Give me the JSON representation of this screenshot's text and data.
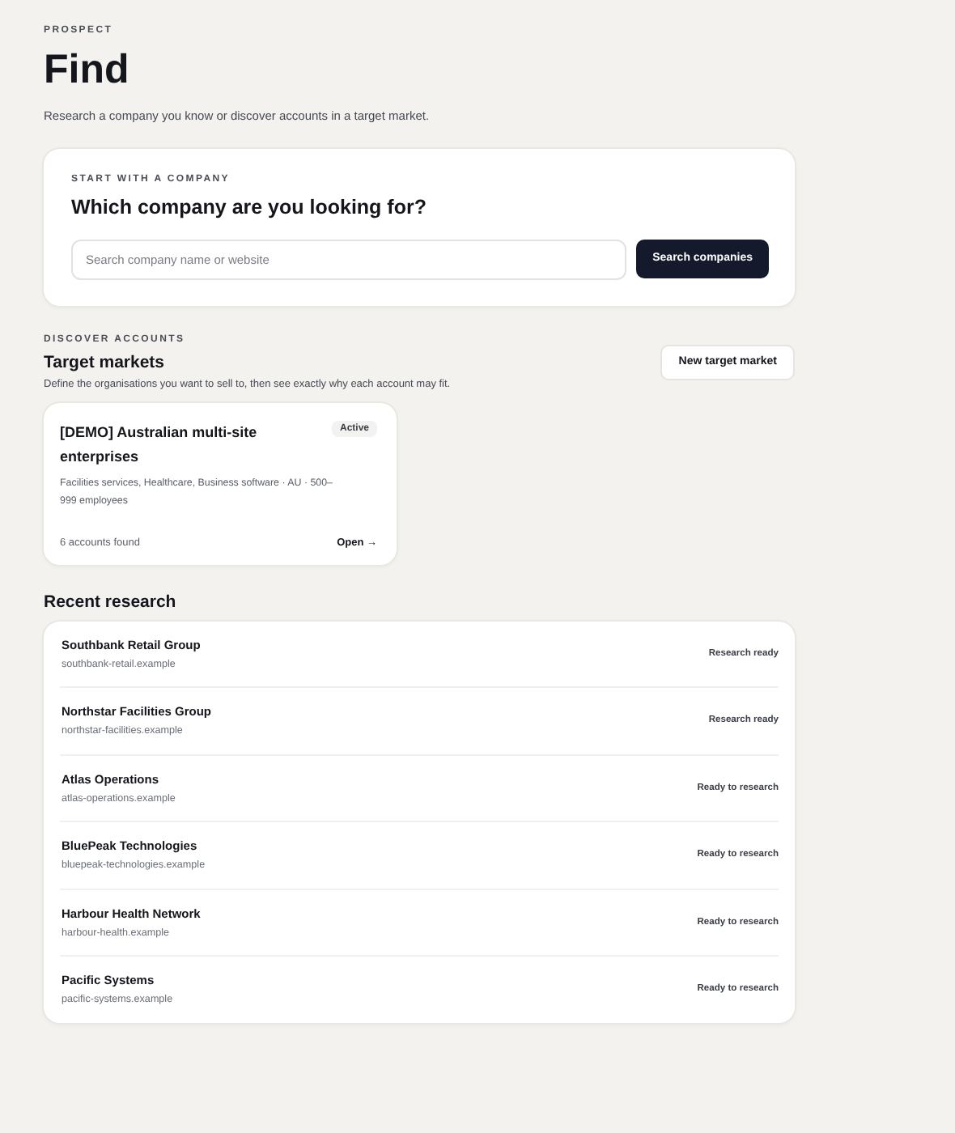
{
  "header": {
    "eyebrow": "PROSPECT",
    "title": "Find",
    "subtitle": "Research a company you know or discover accounts in a target market."
  },
  "company_search": {
    "eyebrow": "START WITH A COMPANY",
    "title": "Which company are you looking for?",
    "placeholder": "Search company name or website",
    "button": "Search companies"
  },
  "discover": {
    "eyebrow": "DISCOVER ACCOUNTS",
    "title": "Target markets",
    "description": "Define the organisations you want to sell to, then see exactly why each account may fit.",
    "button": "New target market",
    "markets": [
      {
        "name": "[DEMO] Australian multi-site enterprises",
        "badge": "Active",
        "details": "Facilities services, Healthcare, Business software · AU · 500–999 employees",
        "count": "6 accounts found",
        "link": "Open →"
      }
    ]
  },
  "recent_research": {
    "title": "Recent research",
    "items": [
      {
        "name": "Southbank Retail Group",
        "domain": "southbank-retail.example",
        "status": "Research ready"
      },
      {
        "name": "Northstar Facilities Group",
        "domain": "northstar-facilities.example",
        "status": "Research ready"
      },
      {
        "name": "Atlas Operations",
        "domain": "atlas-operations.example",
        "status": "Ready to research"
      },
      {
        "name": "BluePeak Technologies",
        "domain": "bluepeak-technologies.example",
        "status": "Ready to research"
      },
      {
        "name": "Harbour Health Network",
        "domain": "harbour-health.example",
        "status": "Ready to research"
      },
      {
        "name": "Pacific Systems",
        "domain": "pacific-systems.example",
        "status": "Ready to research"
      }
    ]
  }
}
